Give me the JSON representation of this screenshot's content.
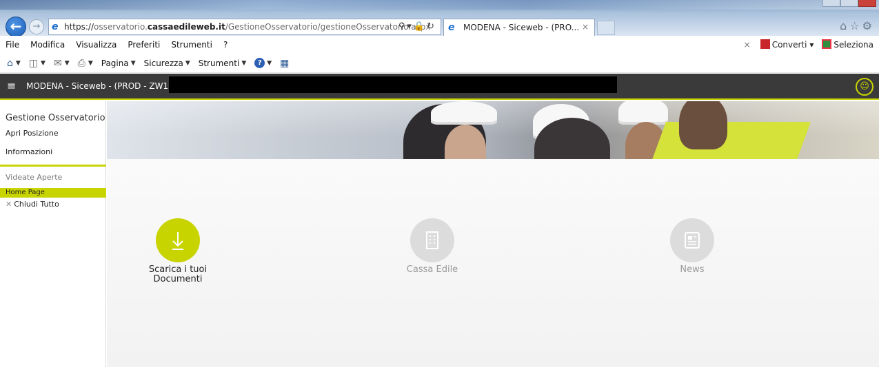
{
  "browser": {
    "url_prefix": "https://",
    "url_sub": "osservatorio.",
    "url_domain": "cassaedileweb.it",
    "url_path": "/GestioneOsservatorio/gestioneOsservatorio.aspx",
    "tab_title": "MODENA - Siceweb - (PRO...",
    "tab_close": "×",
    "menu": [
      "File",
      "Modifica",
      "Visualizza",
      "Preferiti",
      "Strumenti",
      "?"
    ],
    "converti": "Converti",
    "seleziona": "Seleziona",
    "commands": {
      "pagina": "Pagina",
      "sicurezza": "Sicurezza",
      "strumenti": "Strumenti"
    }
  },
  "app": {
    "title": "MODENA - Siceweb - (PROD - ZW1) - E",
    "accent_color": "#c8d400",
    "header_color": "#3a3a3a"
  },
  "sidebar": {
    "group_title": "Gestione Osservatorio",
    "items": [
      "Apri Posizione",
      "Informazioni"
    ],
    "open_views_label": "Videate Aperte",
    "active_view": "Home Page",
    "close_all": "Chiudi Tutto"
  },
  "tiles": [
    {
      "label_line1": "Scarica i tuoi",
      "label_line2": "Documenti",
      "icon": "download-icon",
      "enabled": true
    },
    {
      "label_line1": "Cassa Edile",
      "label_line2": "",
      "icon": "building-icon",
      "enabled": false
    },
    {
      "label_line1": "News",
      "label_line2": "",
      "icon": "newspaper-icon",
      "enabled": false
    }
  ]
}
